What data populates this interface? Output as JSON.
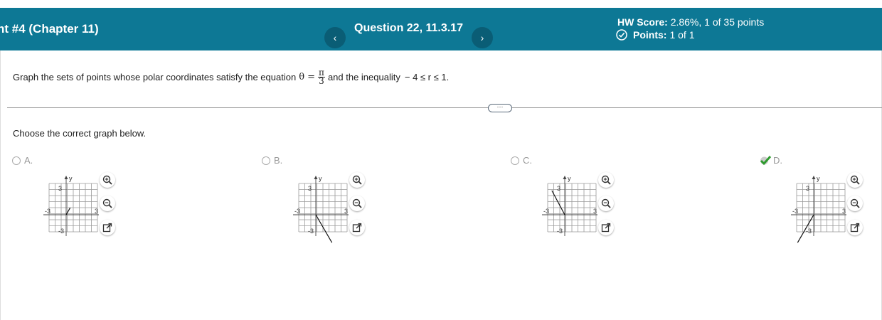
{
  "header": {
    "assignment_title": "nt #4 (Chapter 11)",
    "prev_label": "‹",
    "next_label": "›",
    "question_title": "Question 22, 11.3.17",
    "hw_score_label": "HW Score:",
    "hw_score_value": "2.86%, 1 of 35 points",
    "points_label": "Points:",
    "points_value": "1 of 1"
  },
  "question": {
    "text_before": "Graph the sets of points whose polar coordinates satisfy the equation",
    "eq_lhs": "θ =",
    "frac_num": "π",
    "frac_den": "3",
    "text_middle": "and the inequality",
    "inequality": "− 4 ≤ r ≤ 1."
  },
  "more_button": "···",
  "instruction": "Choose the correct graph below.",
  "options": [
    {
      "letter": "A.",
      "selected": false
    },
    {
      "letter": "B.",
      "selected": false
    },
    {
      "letter": "C.",
      "selected": false
    },
    {
      "letter": "D.",
      "selected": true
    }
  ],
  "graph_labels": {
    "y": "y",
    "x": "x",
    "y_top": "3",
    "y_bottom": "-3",
    "x_left": "-3",
    "x_right": "3"
  },
  "colors": {
    "header": "#0d7895",
    "nav_button": "#0a5d75",
    "correct_check": "#2e9b2e"
  }
}
